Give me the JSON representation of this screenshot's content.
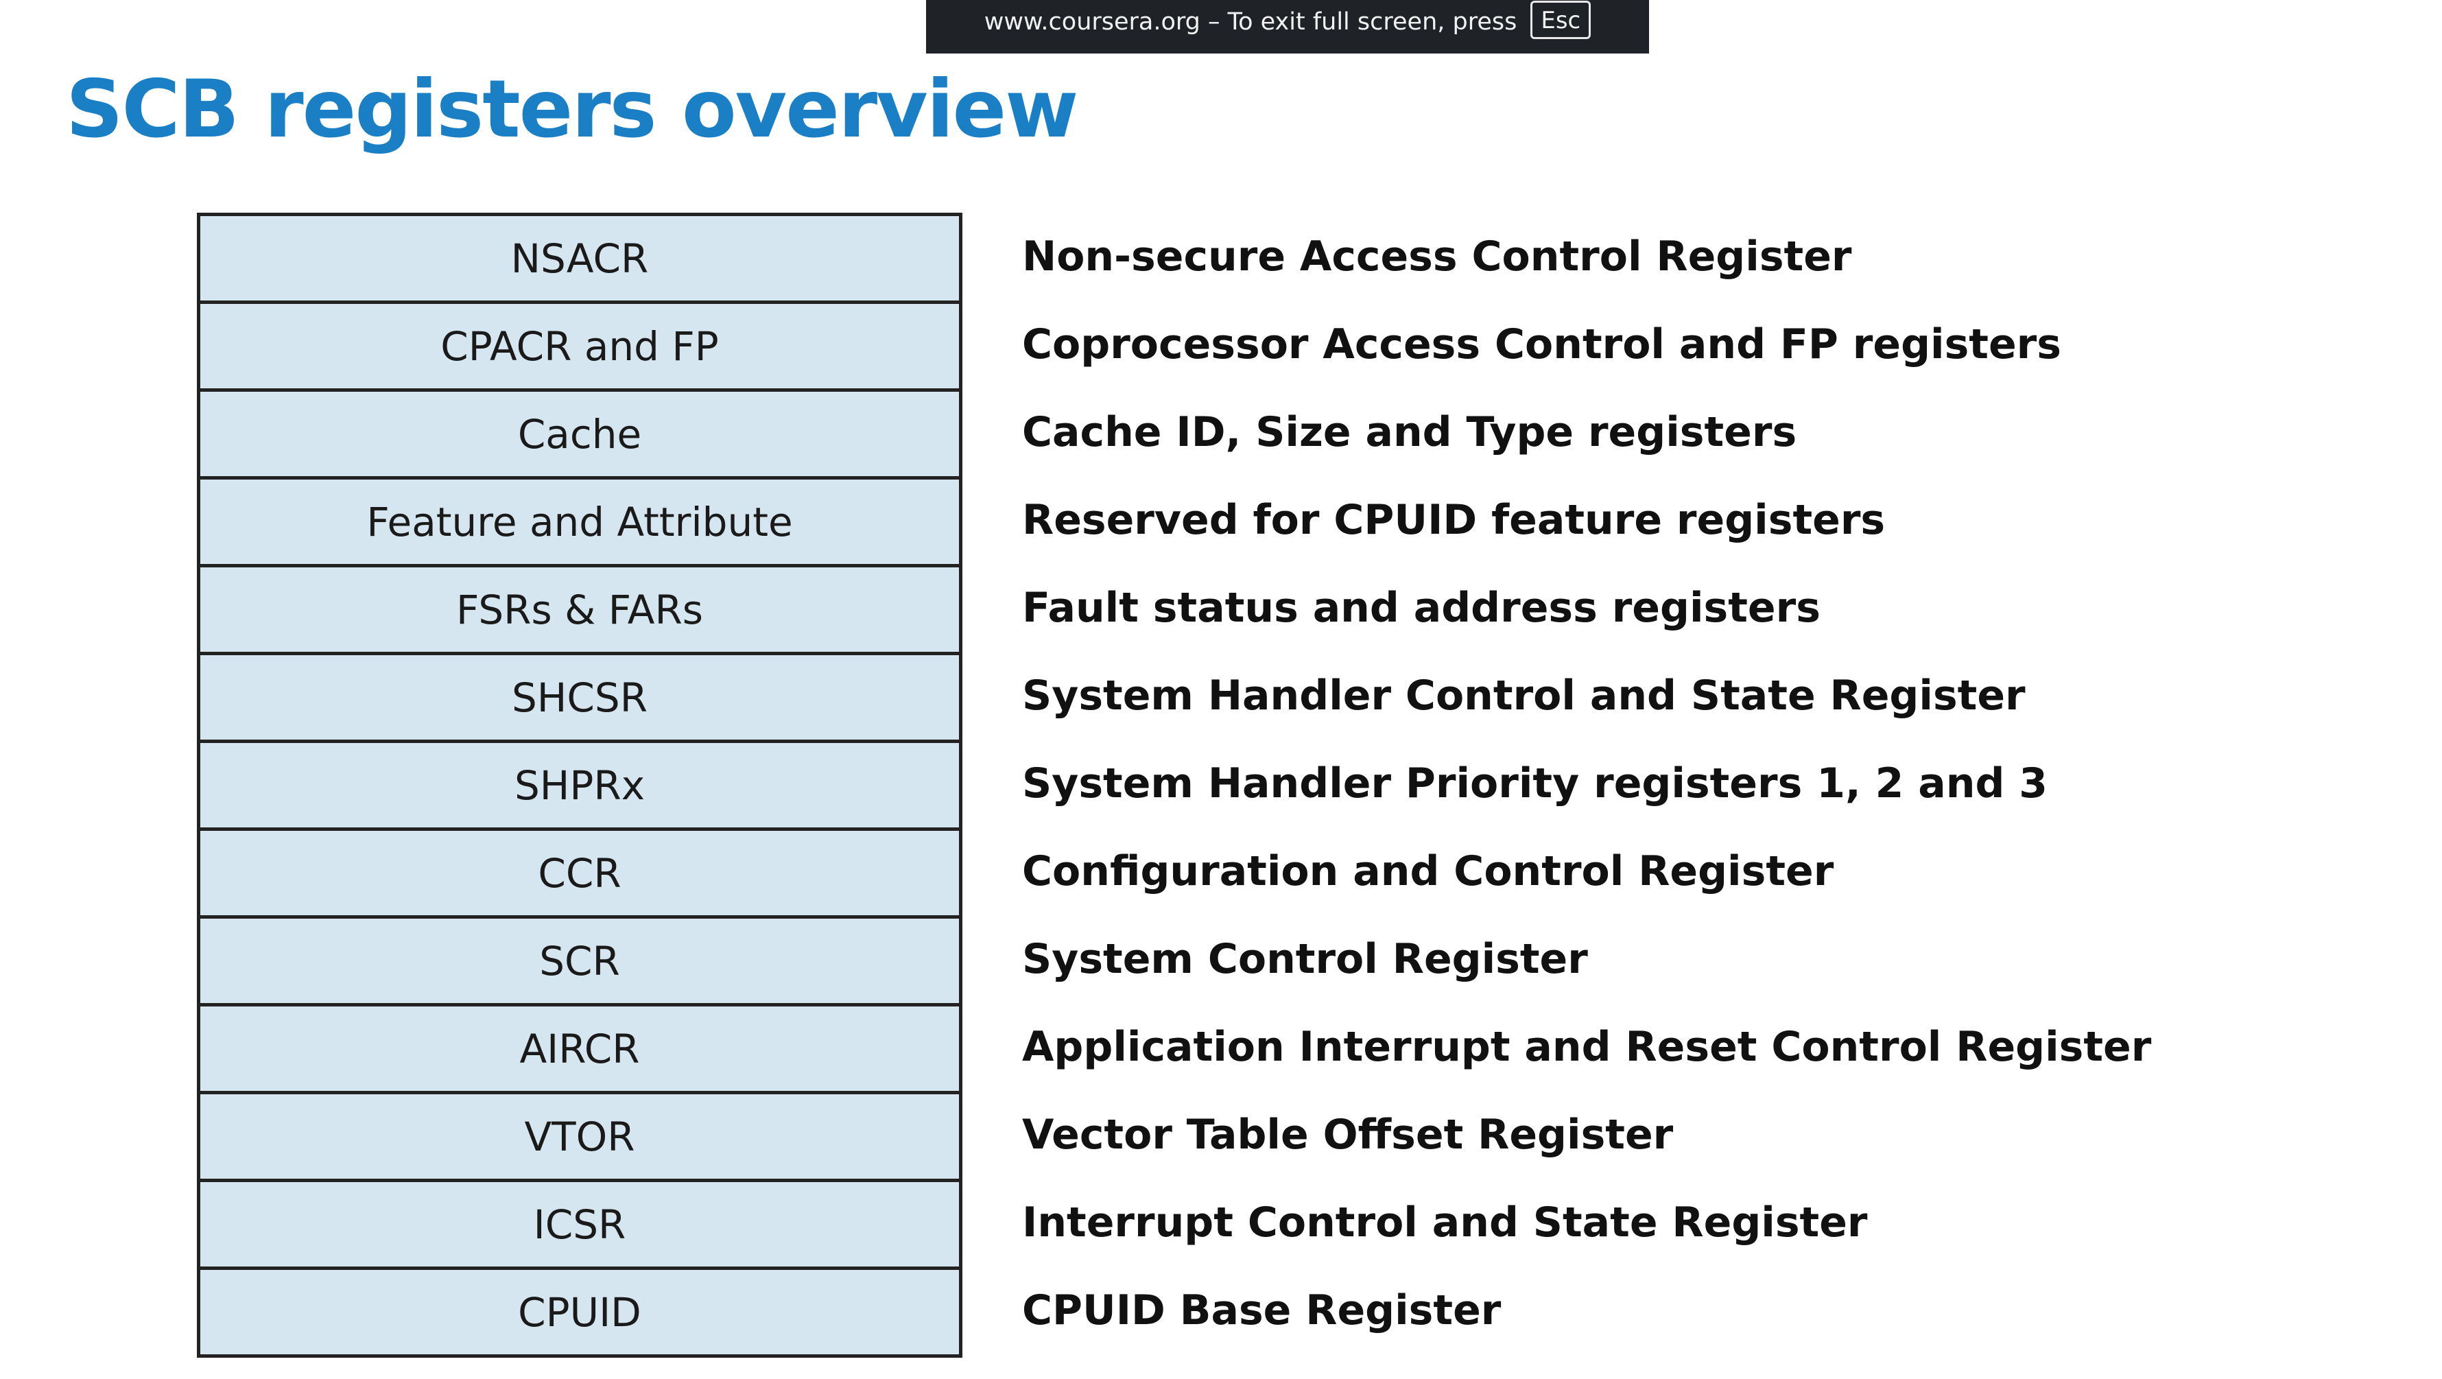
{
  "banner": {
    "text": "www.coursera.org – To exit full screen, press",
    "key": "Esc"
  },
  "slide": {
    "title": "SCB registers overview",
    "registers": [
      {
        "name": "NSACR",
        "description": "Non-secure Access Control Register"
      },
      {
        "name": "CPACR and FP",
        "description": "Coprocessor Access Control and FP registers"
      },
      {
        "name": "Cache",
        "description": "Cache ID, Size and Type registers"
      },
      {
        "name": "Feature and Attribute",
        "description": "Reserved for CPUID feature registers"
      },
      {
        "name": "FSRs & FARs",
        "description": "Fault status and address registers"
      },
      {
        "name": "SHCSR",
        "description": "System Handler Control and State Register"
      },
      {
        "name": "SHPRx",
        "description": "System Handler Priority registers 1, 2 and 3"
      },
      {
        "name": "CCR",
        "description": "Configuration and Control Register"
      },
      {
        "name": "SCR",
        "description": "System Control Register"
      },
      {
        "name": "AIRCR",
        "description": "Application Interrupt and Reset Control Register"
      },
      {
        "name": "VTOR",
        "description": "Vector Table Offset Register"
      },
      {
        "name": "ICSR",
        "description": "Interrupt Control and State Register"
      },
      {
        "name": "CPUID",
        "description": "CPUID Base Register"
      }
    ]
  },
  "colors": {
    "title": "#1a7fc4",
    "cell_fill": "#d6e6f0",
    "cell_border": "#222222",
    "banner_bg": "#1f2328"
  }
}
